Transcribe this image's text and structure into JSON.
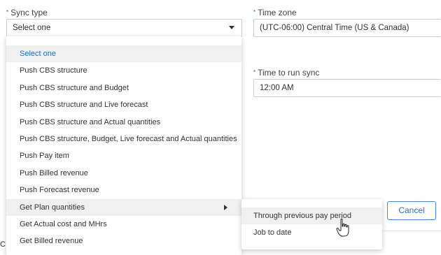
{
  "sync_type": {
    "label": "Sync type",
    "value": "Select one",
    "options": [
      {
        "label": "Select one"
      },
      {
        "label": "Push CBS structure"
      },
      {
        "label": "Push CBS structure and Budget"
      },
      {
        "label": "Push CBS structure and Live forecast"
      },
      {
        "label": "Push CBS structure and Actual quantities"
      },
      {
        "label": "Push CBS structure, Budget, Live forecast and Actual quantities"
      },
      {
        "label": "Push Pay item"
      },
      {
        "label": "Push Billed revenue"
      },
      {
        "label": "Push Forecast revenue"
      },
      {
        "label": "Get Plan quantities"
      },
      {
        "label": "Get Actual cost and MHrs"
      },
      {
        "label": "Get Billed revenue"
      }
    ]
  },
  "time_zone": {
    "label": "Time zone",
    "value": "(UTC-06:00) Central Time (US & Canada)"
  },
  "time_to_run": {
    "label": "Time to run sync",
    "value": "12:00 AM"
  },
  "submenu": {
    "options": [
      {
        "label": "Through previous pay period"
      },
      {
        "label": "Job to date"
      }
    ]
  },
  "footer": {
    "cancel_label": "Cancel",
    "partial_text": "C"
  },
  "colors": {
    "accent": "#1a6fc8",
    "required": "#c0392b",
    "hover_bg": "#f0f0f0",
    "button_border": "#4a86d6"
  }
}
